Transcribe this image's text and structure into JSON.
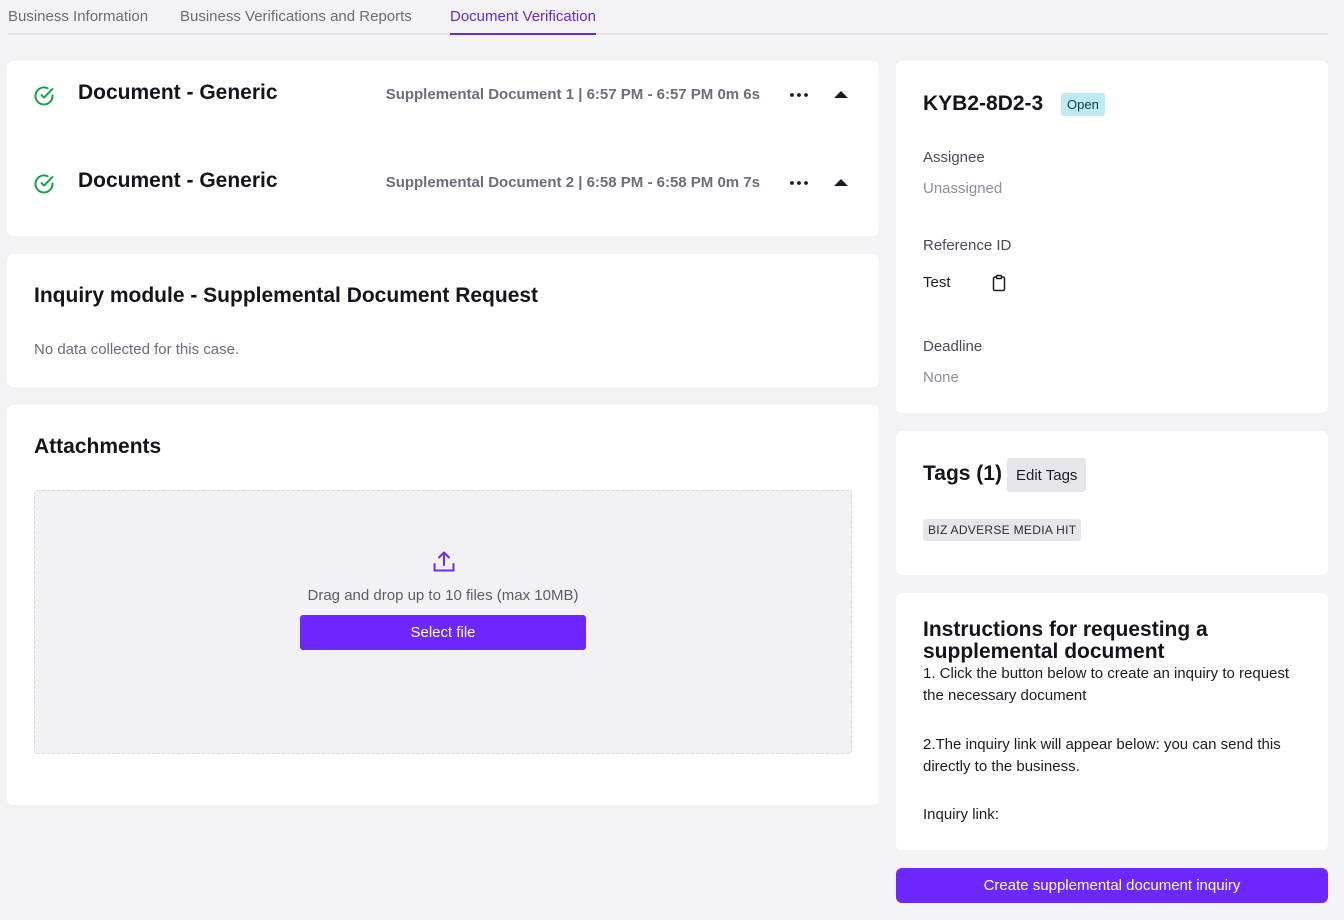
{
  "tabs": [
    {
      "label": "Business Information"
    },
    {
      "label": "Business Verifications and Reports"
    },
    {
      "label": "Document Verification"
    }
  ],
  "verifications": [
    {
      "title": "Document - Generic",
      "meta": "Supplemental Document 1 | 6:57 PM - 6:57 PM  0m 6s"
    },
    {
      "title": "Document - Generic",
      "meta": "Supplemental Document 2 | 6:58 PM - 6:58 PM  0m 7s"
    }
  ],
  "inquiry_module": {
    "title": "Inquiry module - Supplemental Document Request",
    "empty_text": "No data collected for this case."
  },
  "attachments": {
    "title": "Attachments",
    "drop_text": "Drag and drop up to 10 files (max 10MB)",
    "select_label": "Select file"
  },
  "case": {
    "id": "KYB2-8D2-3",
    "status": "Open",
    "assignee_label": "Assignee",
    "assignee_value": "Unassigned",
    "reference_label": "Reference ID",
    "reference_value": "Test",
    "deadline_label": "Deadline",
    "deadline_value": "None"
  },
  "tags": {
    "title": "Tags (1)",
    "edit_label": "Edit Tags",
    "items": [
      "BIZ ADVERSE MEDIA HIT"
    ]
  },
  "instructions": {
    "title": "Instructions for requesting a supplemental document",
    "step1": "1. Click the button below to create an inquiry to request the necessary document",
    "step2": "2.The inquiry link will appear below: you can send this directly to the business.",
    "link_label": "Inquiry link:"
  },
  "create_button_label": "Create supplemental document inquiry",
  "colors": {
    "accent": "#6d28ff",
    "success": "#16a34a",
    "badge_open": "#bdebf1"
  },
  "icons": {
    "check": "check-circle-icon",
    "more": "more-dots-icon",
    "collapse": "caret-up-icon",
    "upload": "upload-icon",
    "clipboard": "clipboard-icon"
  }
}
